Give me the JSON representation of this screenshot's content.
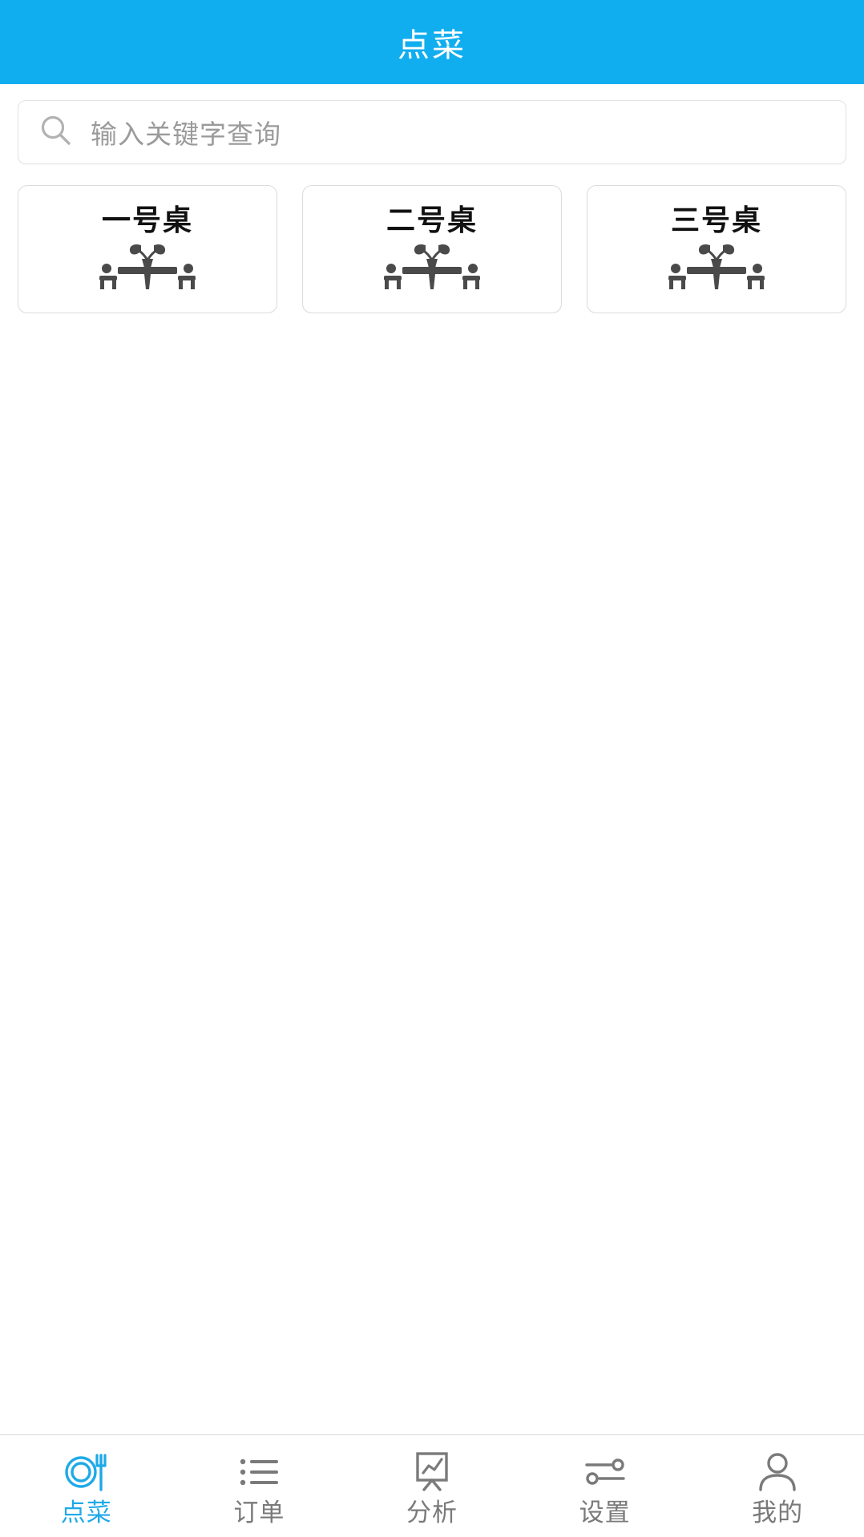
{
  "header": {
    "title": "点菜",
    "background_color": "#11AEEF",
    "title_color": "#FFFFFF"
  },
  "search": {
    "placeholder": "输入关键字查询",
    "value": "",
    "icon": "search-icon"
  },
  "tables": [
    {
      "label": "一号桌",
      "icon": "dining-table-icon"
    },
    {
      "label": "二号桌",
      "icon": "dining-table-icon"
    },
    {
      "label": "三号桌",
      "icon": "dining-table-icon"
    }
  ],
  "tabbar": {
    "active_color": "#1EA9E8",
    "inactive_color": "#7A7A7A",
    "items": [
      {
        "label": "点菜",
        "icon": "plate-fork-icon",
        "active": true
      },
      {
        "label": "订单",
        "icon": "list-icon",
        "active": false
      },
      {
        "label": "分析",
        "icon": "chart-board-icon",
        "active": false
      },
      {
        "label": "设置",
        "icon": "sliders-icon",
        "active": false
      },
      {
        "label": "我的",
        "icon": "person-icon",
        "active": false
      }
    ]
  }
}
